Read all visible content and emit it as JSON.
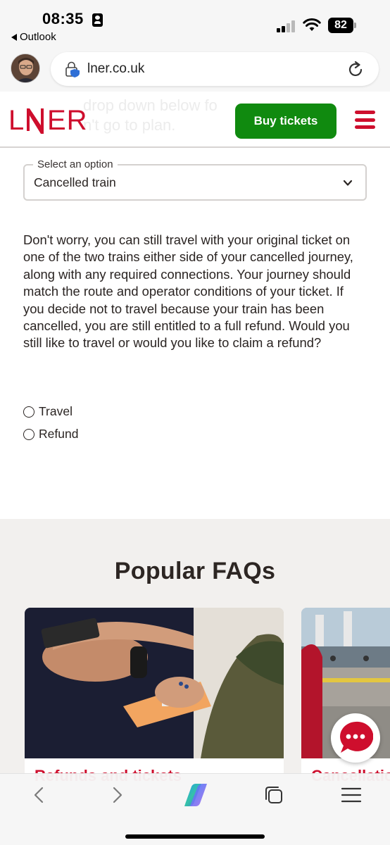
{
  "status_bar": {
    "time": "08:35",
    "back_app": "Outlook",
    "battery": "82"
  },
  "browser": {
    "url": "lner.co.uk"
  },
  "header": {
    "logo_text": "LNER",
    "ghost_text_line1": "drop down below fo",
    "ghost_text_line2": "n't go to plan.",
    "buy_tickets_label": "Buy tickets",
    "brand_color": "#ce0e2d",
    "button_color": "#108a0f"
  },
  "form": {
    "select_label": "Select an option",
    "select_value": "Cancelled train",
    "info_text": "Don't worry, you can still travel with your original ticket on one of the two trains either side of your cancelled journey, along with any required connections. Your journey should match the route and operator conditions of your ticket. If you decide not to travel because your train has been cancelled, you are still entitled to a full refund. Would you still like to travel or would you like to claim a refund?",
    "options": [
      "Travel",
      "Refund"
    ]
  },
  "faq": {
    "title": "Popular FAQs",
    "cards": [
      {
        "title": "Refunds and tickets"
      },
      {
        "title": "Cancellations"
      }
    ]
  },
  "icons": {
    "status": [
      "id-card-icon",
      "signal-icon",
      "wifi-icon",
      "battery-icon"
    ],
    "browser": [
      "lock-icon",
      "reload-icon",
      "back-icon",
      "forward-icon",
      "copilot-icon",
      "tabs-icon",
      "menu-icon"
    ],
    "page": [
      "hamburger-icon",
      "chevron-down-icon",
      "chat-icon"
    ]
  }
}
